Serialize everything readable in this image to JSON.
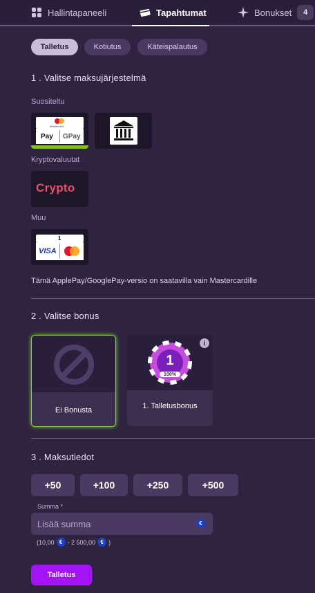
{
  "nav": {
    "dashboard": "Hallintapaneeli",
    "events": "Tapahtumat",
    "bonuses": "Bonukset",
    "bonus_count": "4"
  },
  "tabs": [
    {
      "label": "Talletus",
      "active": true
    },
    {
      "label": "Kotiutus",
      "active": false
    },
    {
      "label": "Käteispalautus",
      "active": false
    }
  ],
  "step1": {
    "title": "1 . Valitse maksujärjestelmä",
    "recommended_label": "Suositeltu",
    "crypto_label": "Kryptovaluutat",
    "other_label": "Muu",
    "methods": {
      "mastercard_text": "Mastercard",
      "applepay": "Pay",
      "googlepay": "GPay",
      "crypto": "Crypto",
      "visa": "VISA",
      "card_number": "1"
    },
    "note": "Tämä ApplePay/GooglePay-versio on saatavilla vain Mastercardille"
  },
  "step2": {
    "title": "2 . Valitse bonus",
    "bonuses": [
      {
        "label": "Ei Bonusta",
        "selected": true
      },
      {
        "label": "1. Talletusbonus",
        "selected": false,
        "chip_number": "1",
        "chip_percent": "100%"
      }
    ],
    "info_icon": "i"
  },
  "step3": {
    "title": "3 . Maksutiedot",
    "quick_amounts": [
      "+50",
      "+100",
      "+250",
      "+500"
    ],
    "field_label": "Summa *",
    "placeholder": "Lisää summa",
    "currency_symbol": "€",
    "range_open": "(10,00",
    "range_sep": "- 2 500,00",
    "range_close": ")"
  },
  "submit_label": "Talletus",
  "colors": {
    "background": "#2f2340",
    "accent_purple": "#a214f2",
    "selected_green": "#8dd23a",
    "euro_blue": "#1b3fc7"
  },
  "icons": [
    "grid-icon",
    "ticket-icon",
    "sparkle-icon",
    "bank-icon",
    "info-icon",
    "euro-icon",
    "no-bonus-icon",
    "bonus-chip-icon"
  ]
}
